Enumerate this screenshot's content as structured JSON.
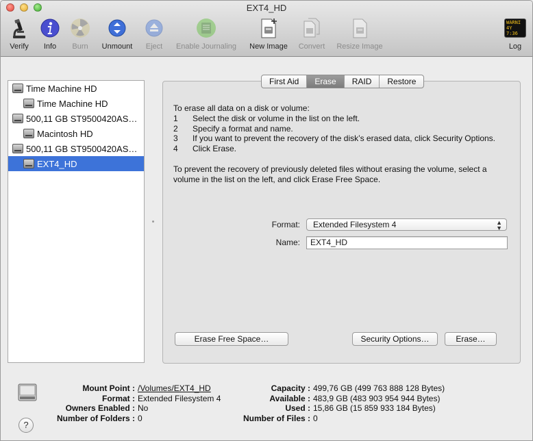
{
  "window": {
    "title": "EXT4_HD"
  },
  "toolbar": {
    "items": [
      {
        "label": "Verify",
        "enabled": true,
        "icon": "microscope-icon"
      },
      {
        "label": "Info",
        "enabled": true,
        "icon": "info-icon"
      },
      {
        "label": "Burn",
        "enabled": false,
        "icon": "radioactive-icon"
      },
      {
        "label": "Unmount",
        "enabled": true,
        "icon": "unmount-icon"
      },
      {
        "label": "Eject",
        "enabled": false,
        "icon": "eject-icon"
      },
      {
        "label": "Enable Journaling",
        "enabled": false,
        "icon": "journal-icon"
      },
      {
        "label": "New Image",
        "enabled": true,
        "icon": "new-image-icon"
      },
      {
        "label": "Convert",
        "enabled": false,
        "icon": "convert-icon"
      },
      {
        "label": "Resize Image",
        "enabled": false,
        "icon": "resize-image-icon"
      },
      {
        "label": "Log",
        "enabled": true,
        "icon": "console-log-icon",
        "badge_line1": "WARNI",
        "badge_line2": "4Y 7:36"
      }
    ]
  },
  "sidebar": {
    "items": [
      {
        "label": "Time Machine HD",
        "indent": 0,
        "selected": false
      },
      {
        "label": "Time Machine HD",
        "indent": 1,
        "selected": false
      },
      {
        "label": "500,11 GB ST9500420AS…",
        "indent": 0,
        "selected": false
      },
      {
        "label": "Macintosh HD",
        "indent": 1,
        "selected": false
      },
      {
        "label": "500,11 GB ST9500420AS…",
        "indent": 0,
        "selected": false
      },
      {
        "label": "EXT4_HD",
        "indent": 1,
        "selected": true
      }
    ]
  },
  "tabs": [
    {
      "label": "First Aid",
      "active": false
    },
    {
      "label": "Erase",
      "active": true
    },
    {
      "label": "RAID",
      "active": false
    },
    {
      "label": "Restore",
      "active": false
    }
  ],
  "erase": {
    "intro": "To erase all data on a disk or volume:",
    "steps": [
      {
        "num": "1",
        "text": "Select the disk or volume in the list on the left."
      },
      {
        "num": "2",
        "text": "Specify a format and name."
      },
      {
        "num": "3",
        "text": "If you want to prevent the recovery of the disk’s erased data, click Security Options."
      },
      {
        "num": "4",
        "text": "Click Erase."
      }
    ],
    "free_space_text": "To prevent the recovery of previously deleted files without erasing the volume, select a volume in the list on the left, and click Erase Free Space.",
    "format_label": "Format:",
    "format_value": "Extended Filesystem 4",
    "name_label": "Name:",
    "name_value": "EXT4_HD",
    "erase_free_space_button": "Erase Free Space…",
    "security_options_button": "Security Options…",
    "erase_button": "Erase…"
  },
  "info": {
    "left": [
      {
        "key": "Mount Point :",
        "value": "/Volumes/EXT4_HD",
        "link": true
      },
      {
        "key": "Format :",
        "value": "Extended Filesystem 4"
      },
      {
        "key": "Owners Enabled :",
        "value": "No"
      },
      {
        "key": "Number of Folders :",
        "value": "0"
      }
    ],
    "right": [
      {
        "key": "Capacity :",
        "value": "499,76 GB (499 763 888 128 Bytes)"
      },
      {
        "key": "Available :",
        "value": "483,9 GB (483 903 954 944 Bytes)"
      },
      {
        "key": "Used :",
        "value": "15,86 GB (15 859 933 184 Bytes)"
      },
      {
        "key": "Number of Files :",
        "value": "0"
      }
    ],
    "help_label": "?"
  }
}
